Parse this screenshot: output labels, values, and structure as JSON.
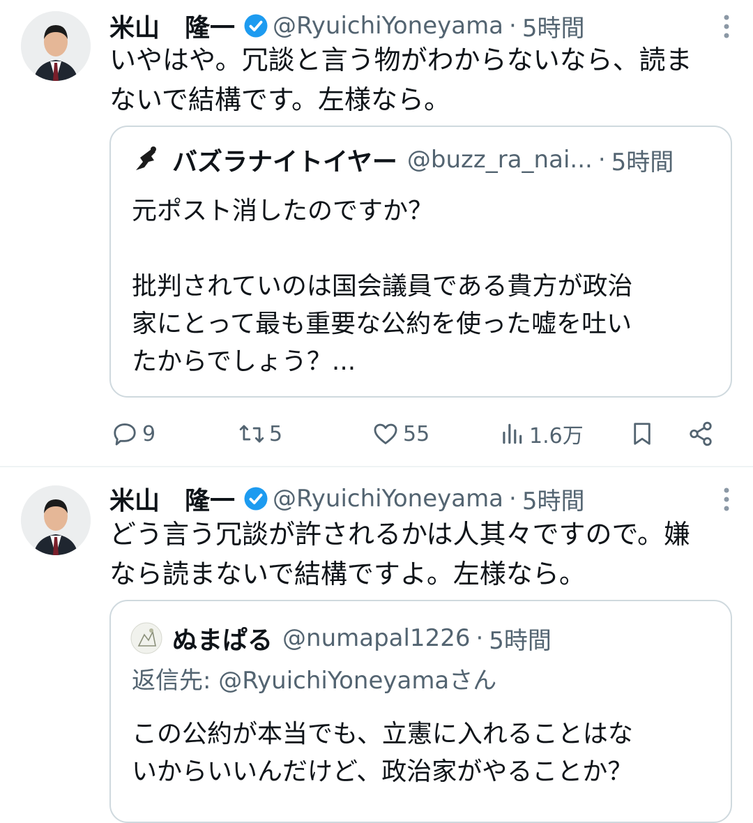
{
  "tweets": [
    {
      "author": {
        "name": "米山　隆一",
        "handle": "@RyuichiYoneyama",
        "separator": "·",
        "time": "5時間"
      },
      "text_lines": [
        "いやはや。冗談と言う物がわからないなら、読ま",
        "ないで結構です。左様なら。"
      ],
      "quote": {
        "author": {
          "name": "バズラナイトイヤー",
          "handle": "@buzz_ra_nai...",
          "separator": "·",
          "time": "5時間"
        },
        "text_lines": [
          "元ポスト消したのですか？",
          "",
          "批判されていのは国会議員である貴方が政治",
          "家にとって最も重要な公約を使った嘘を吐い",
          "たからでしょう？..."
        ]
      },
      "stats": {
        "replies": "9",
        "reposts": "5",
        "likes": "55",
        "views": "1.6万"
      }
    },
    {
      "author": {
        "name": "米山　隆一",
        "handle": "@RyuichiYoneyama",
        "separator": "·",
        "time": "5時間"
      },
      "text_lines": [
        "どう言う冗談が許されるかは人其々ですので。嫌",
        "なら読まないで結構ですよ。左様なら。"
      ],
      "quote": {
        "author": {
          "name": "ぬまぱる",
          "handle": "@numapal1226",
          "separator": "·",
          "time": "5時間"
        },
        "reply_to": {
          "prefix": "返信先: ",
          "handle": "@RyuichiYoneyama",
          "suffix": "さん"
        },
        "text_lines": [
          "この公約が本当でも、立憲に入れることはな",
          "いからいいんだけど、政治家がやることか？"
        ]
      }
    }
  ],
  "icons": {
    "verified": "verified-badge-icon",
    "more": "more-vertical-icon",
    "reply": "reply-icon",
    "repost": "repost-icon",
    "like": "heart-icon",
    "views": "views-icon",
    "bookmark": "bookmark-icon",
    "share": "share-icon"
  },
  "colors": {
    "verified": "#1d9bf0",
    "muted": "#536471",
    "text": "#0f1419",
    "border": "#cfd9de"
  }
}
